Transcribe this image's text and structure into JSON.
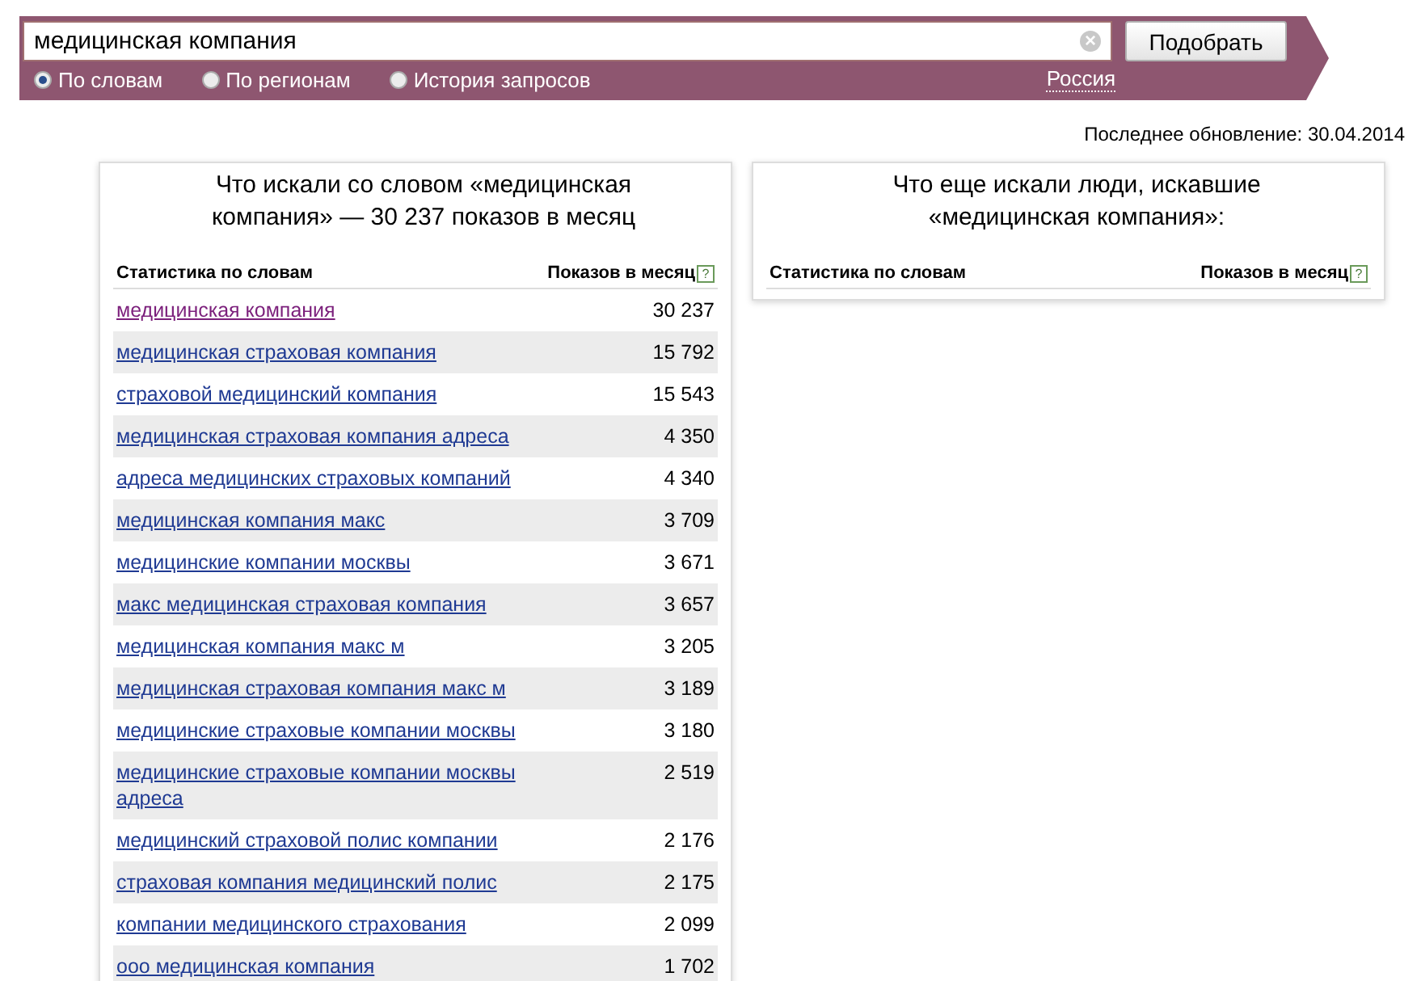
{
  "search": {
    "value": "медицинская компания",
    "clear_icon": "×",
    "button": "Подобрать",
    "modes": [
      {
        "label": "По словам",
        "selected": true
      },
      {
        "label": "По регионам",
        "selected": false
      },
      {
        "label": "История запросов",
        "selected": false
      }
    ],
    "region": "Россия"
  },
  "last_update": "Последнее обновление: 30.04.2014",
  "panels": [
    {
      "title": "Что искали со словом «медицинская компания» — 30 237 показов в месяц",
      "columns": [
        "Статистика по словам",
        "Показов в месяц"
      ],
      "help": "?",
      "rows": [
        {
          "phrase": "медицинская компания",
          "count": "30 237",
          "visited": true
        },
        {
          "phrase": "медицинская страховая компания",
          "count": "15 792",
          "visited": false
        },
        {
          "phrase": "страховой медицинский компания",
          "count": "15 543",
          "visited": false
        },
        {
          "phrase": "медицинская страховая компания адреса",
          "count": "4 350",
          "visited": false
        },
        {
          "phrase": "адреса медицинских страховых компаний",
          "count": "4 340",
          "visited": false
        },
        {
          "phrase": "медицинская компания макс",
          "count": "3 709",
          "visited": false
        },
        {
          "phrase": "медицинские компании москвы",
          "count": "3 671",
          "visited": false
        },
        {
          "phrase": "макс медицинская страховая компания",
          "count": "3 657",
          "visited": false
        },
        {
          "phrase": "медицинская компания макс м",
          "count": "3 205",
          "visited": false
        },
        {
          "phrase": "медицинская страховая компания макс м",
          "count": "3 189",
          "visited": false
        },
        {
          "phrase": "медицинские страховые компании москвы",
          "count": "3 180",
          "visited": false
        },
        {
          "phrase": "медицинские страховые компании москвы адреса",
          "count": "2 519",
          "visited": false
        },
        {
          "phrase": "медицинский страховой полис компании",
          "count": "2 176",
          "visited": false
        },
        {
          "phrase": "страховая компания медицинский полис",
          "count": "2 175",
          "visited": false
        },
        {
          "phrase": "компании медицинского страхования",
          "count": "2 099",
          "visited": false
        },
        {
          "phrase": "ооо медицинская компания",
          "count": "1 702",
          "visited": false
        }
      ]
    },
    {
      "title": "Что еще искали люди, искавшие «медицинская компания»:",
      "columns": [
        "Статистика по словам",
        "Показов в месяц"
      ],
      "help": "?"
    }
  ]
}
